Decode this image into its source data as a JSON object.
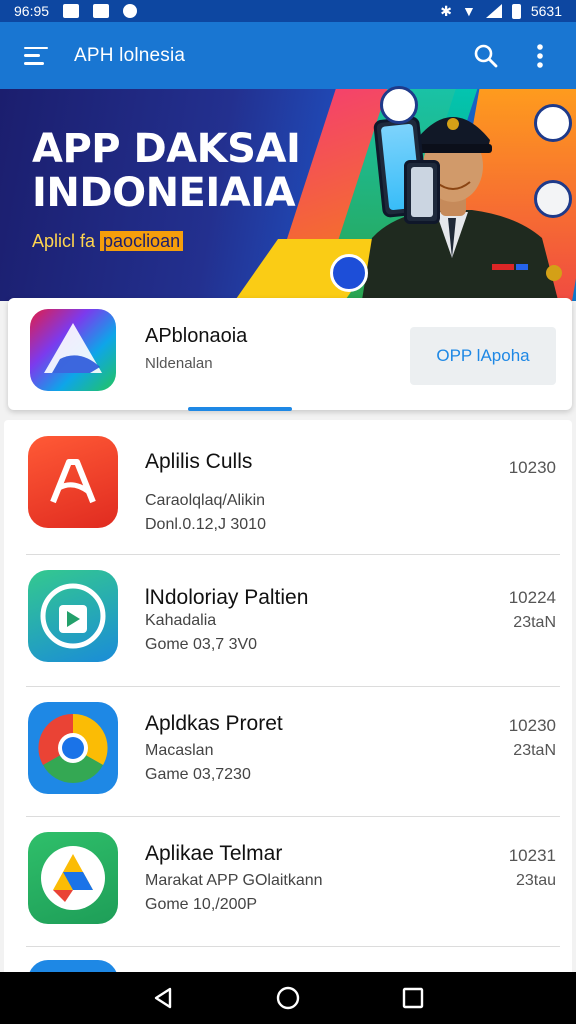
{
  "status_bar": {
    "time_left": "96:95",
    "time_right": "5631"
  },
  "app_bar": {
    "title": "APH lolnesia",
    "menu_icon": "menu-icon",
    "search_icon": "search-icon",
    "more_icon": "more-vert-icon"
  },
  "hero": {
    "title": "APP DAKSAI\nINDONEIAIA",
    "subtitle_plain": "Aplicl fa ",
    "subtitle_highlight": "paoclioan"
  },
  "featured": {
    "name": "APblonaoia",
    "subtitle": "Nldenalan",
    "button_label": "OPP lApoha"
  },
  "apps": [
    {
      "name": "Aplilis Culls",
      "line1": "Caraolqlaq/Alikin",
      "line2": "Donl.0.12,J 3010",
      "time": "10230",
      "size": "",
      "icon": "adobe-acrobat-icon",
      "color": "#ef4426"
    },
    {
      "name": "lNdoloriay Paltien",
      "line1": "Kahadalia",
      "line2": "Gome 03,7 3V0",
      "time": "10224",
      "size": "23taN",
      "icon": "play-store-icon",
      "color": "#22a06b"
    },
    {
      "name": "Apldkas Proret",
      "line1": "Macaslan",
      "line2": "Game 03,7230",
      "time": "10230",
      "size": "23taN",
      "icon": "chrome-icon",
      "color": "#1e88e5"
    },
    {
      "name": "Aplikae Telmar",
      "line1": "Marakat APP GOlaitkann",
      "line2": "Gome 10,/200P",
      "time": "10231",
      "size": "23tau",
      "icon": "drive-icon",
      "color": "#21a35a"
    }
  ],
  "nav": {
    "back_icon": "back-icon",
    "home_icon": "home-icon",
    "recents_icon": "recents-icon"
  }
}
